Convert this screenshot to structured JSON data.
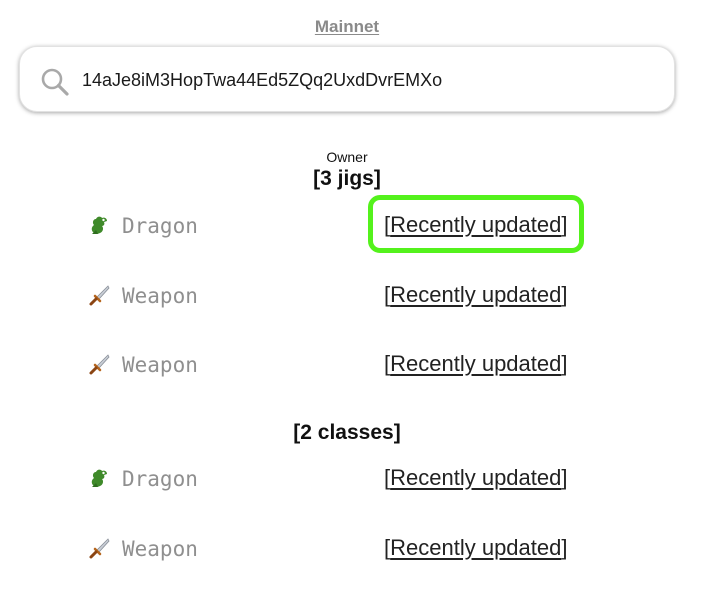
{
  "header": {
    "network_label": "Mainnet"
  },
  "search": {
    "value": "14aJe8iM3HopTwa44Ed5ZQq2UxdDvrEMXo",
    "icon": "search-icon"
  },
  "owner": {
    "label": "Owner"
  },
  "jigs": {
    "heading": "[3 jigs]",
    "items": [
      {
        "name": "Dragon",
        "icon": "dragon-icon",
        "link_label": "Recently updated",
        "highlighted": true
      },
      {
        "name": "Weapon",
        "icon": "dagger-icon",
        "link_label": "Recently updated",
        "highlighted": false
      },
      {
        "name": "Weapon",
        "icon": "dagger-icon",
        "link_label": "Recently updated",
        "highlighted": false
      }
    ]
  },
  "classes": {
    "heading": "[2 classes]",
    "items": [
      {
        "name": "Dragon",
        "icon": "dragon-icon",
        "link_label": "Recently updated"
      },
      {
        "name": "Weapon",
        "icon": "dagger-icon",
        "link_label": "Recently updated"
      }
    ]
  },
  "colors": {
    "highlight": "#54f21c",
    "muted_text": "#8f8f8f",
    "network_link": "#8a8a8a"
  }
}
